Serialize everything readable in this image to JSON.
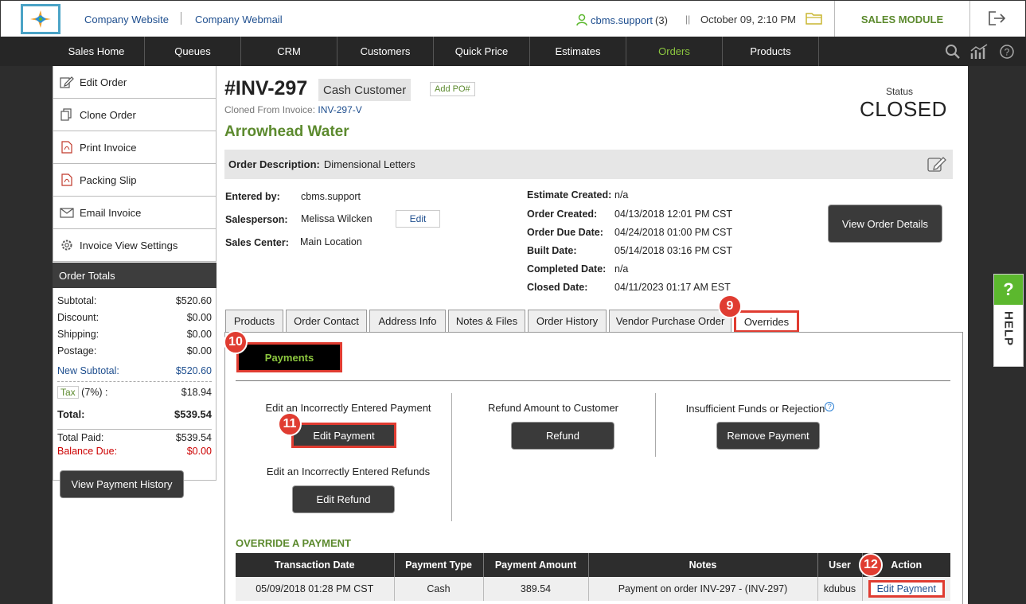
{
  "topbar": {
    "company_website": "Company Website",
    "company_webmail": "Company Webmail",
    "user": "cbms.support",
    "user_count": "(3)",
    "divider": "||",
    "datetime": "October 09, 2:10 PM",
    "module": "SALES MODULE"
  },
  "nav": [
    "Sales Home",
    "Queues",
    "CRM",
    "Customers",
    "Quick Price",
    "Estimates",
    "Orders",
    "Products"
  ],
  "sidebar": {
    "items": [
      "Edit Order",
      "Clone Order",
      "Print Invoice",
      "Packing Slip",
      "Email Invoice",
      "Invoice View Settings"
    ],
    "totals_title": "Order Totals",
    "subtotal_label": "Subtotal:",
    "subtotal": "$520.60",
    "discount_label": "Discount:",
    "discount": "$0.00",
    "shipping_label": "Shipping:",
    "shipping": "$0.00",
    "postage_label": "Postage:",
    "postage": "$0.00",
    "new_subtotal_label": "New Subtotal:",
    "new_subtotal": "$520.60",
    "tax_label": "Tax",
    "tax_pct": "(7%) :",
    "tax": "$18.94",
    "total_label": "Total:",
    "total": "$539.54",
    "total_paid_label": "Total Paid:",
    "total_paid": "$539.54",
    "balance_due_label": "Balance Due:",
    "balance_due": "$0.00",
    "payment_history_button": "View Payment History"
  },
  "order": {
    "number": "#INV-297",
    "customer_type": "Cash Customer",
    "add_po": "Add PO#",
    "cloned_from_label": "Cloned From Invoice:",
    "cloned_from": "INV-297-V",
    "customer_name": "Arrowhead Water",
    "status_label": "Status",
    "status": "CLOSED",
    "description_label": "Order Description:",
    "description": "Dimensional Letters",
    "entered_by_label": "Entered by:",
    "entered_by": "cbms.support",
    "salesperson_label": "Salesperson:",
    "salesperson": "Melissa Wilcken",
    "edit_label": "Edit",
    "sales_center_label": "Sales Center:",
    "sales_center": "Main Location",
    "estimate_created_label": "Estimate Created:",
    "estimate_created": "n/a",
    "order_created_label": "Order Created:",
    "order_created": "04/13/2018 12:01 PM CST",
    "order_due_label": "Order Due Date:",
    "order_due": "04/24/2018 01:00 PM CST",
    "built_label": "Built Date:",
    "built": "05/14/2018 03:16 PM CST",
    "completed_label": "Completed Date:",
    "completed": "n/a",
    "closed_label": "Closed Date:",
    "closed": "04/11/2023 01:17 AM EST",
    "view_details_button": "View Order Details"
  },
  "tabs": [
    "Products",
    "Order Contact",
    "Address Info",
    "Notes & Files",
    "Order History",
    "Vendor Purchase Order",
    "Overrides"
  ],
  "overrides": {
    "payments_button": "Payments",
    "edit_payment_label": "Edit an Incorrectly Entered Payment",
    "edit_payment_button": "Edit Payment",
    "edit_refunds_label": "Edit an Incorrectly Entered Refunds",
    "edit_refund_button": "Edit Refund",
    "refund_label": "Refund Amount to Customer",
    "refund_button": "Refund",
    "nsf_label": "Insufficient Funds or Rejection",
    "remove_payment_button": "Remove Payment",
    "section_title": "OVERRIDE A PAYMENT",
    "columns": [
      "Transaction Date",
      "Payment Type",
      "Payment Amount",
      "Notes",
      "User",
      "Action"
    ],
    "rows": [
      {
        "date": "05/09/2018 01:28 PM CST",
        "type": "Cash",
        "amount": "389.54",
        "notes": "Payment on order INV-297 - (INV-297)",
        "user": "kdubus",
        "action": "Edit Payment"
      }
    ]
  },
  "badges": [
    "9",
    "10",
    "11",
    "12"
  ],
  "help": {
    "q": "?",
    "label": "HELP"
  },
  "colors": {
    "accent_green": "#5c8a2e",
    "highlight_red": "#e03c31",
    "nav_bg": "#262626",
    "active_nav": "#8cc63f"
  }
}
